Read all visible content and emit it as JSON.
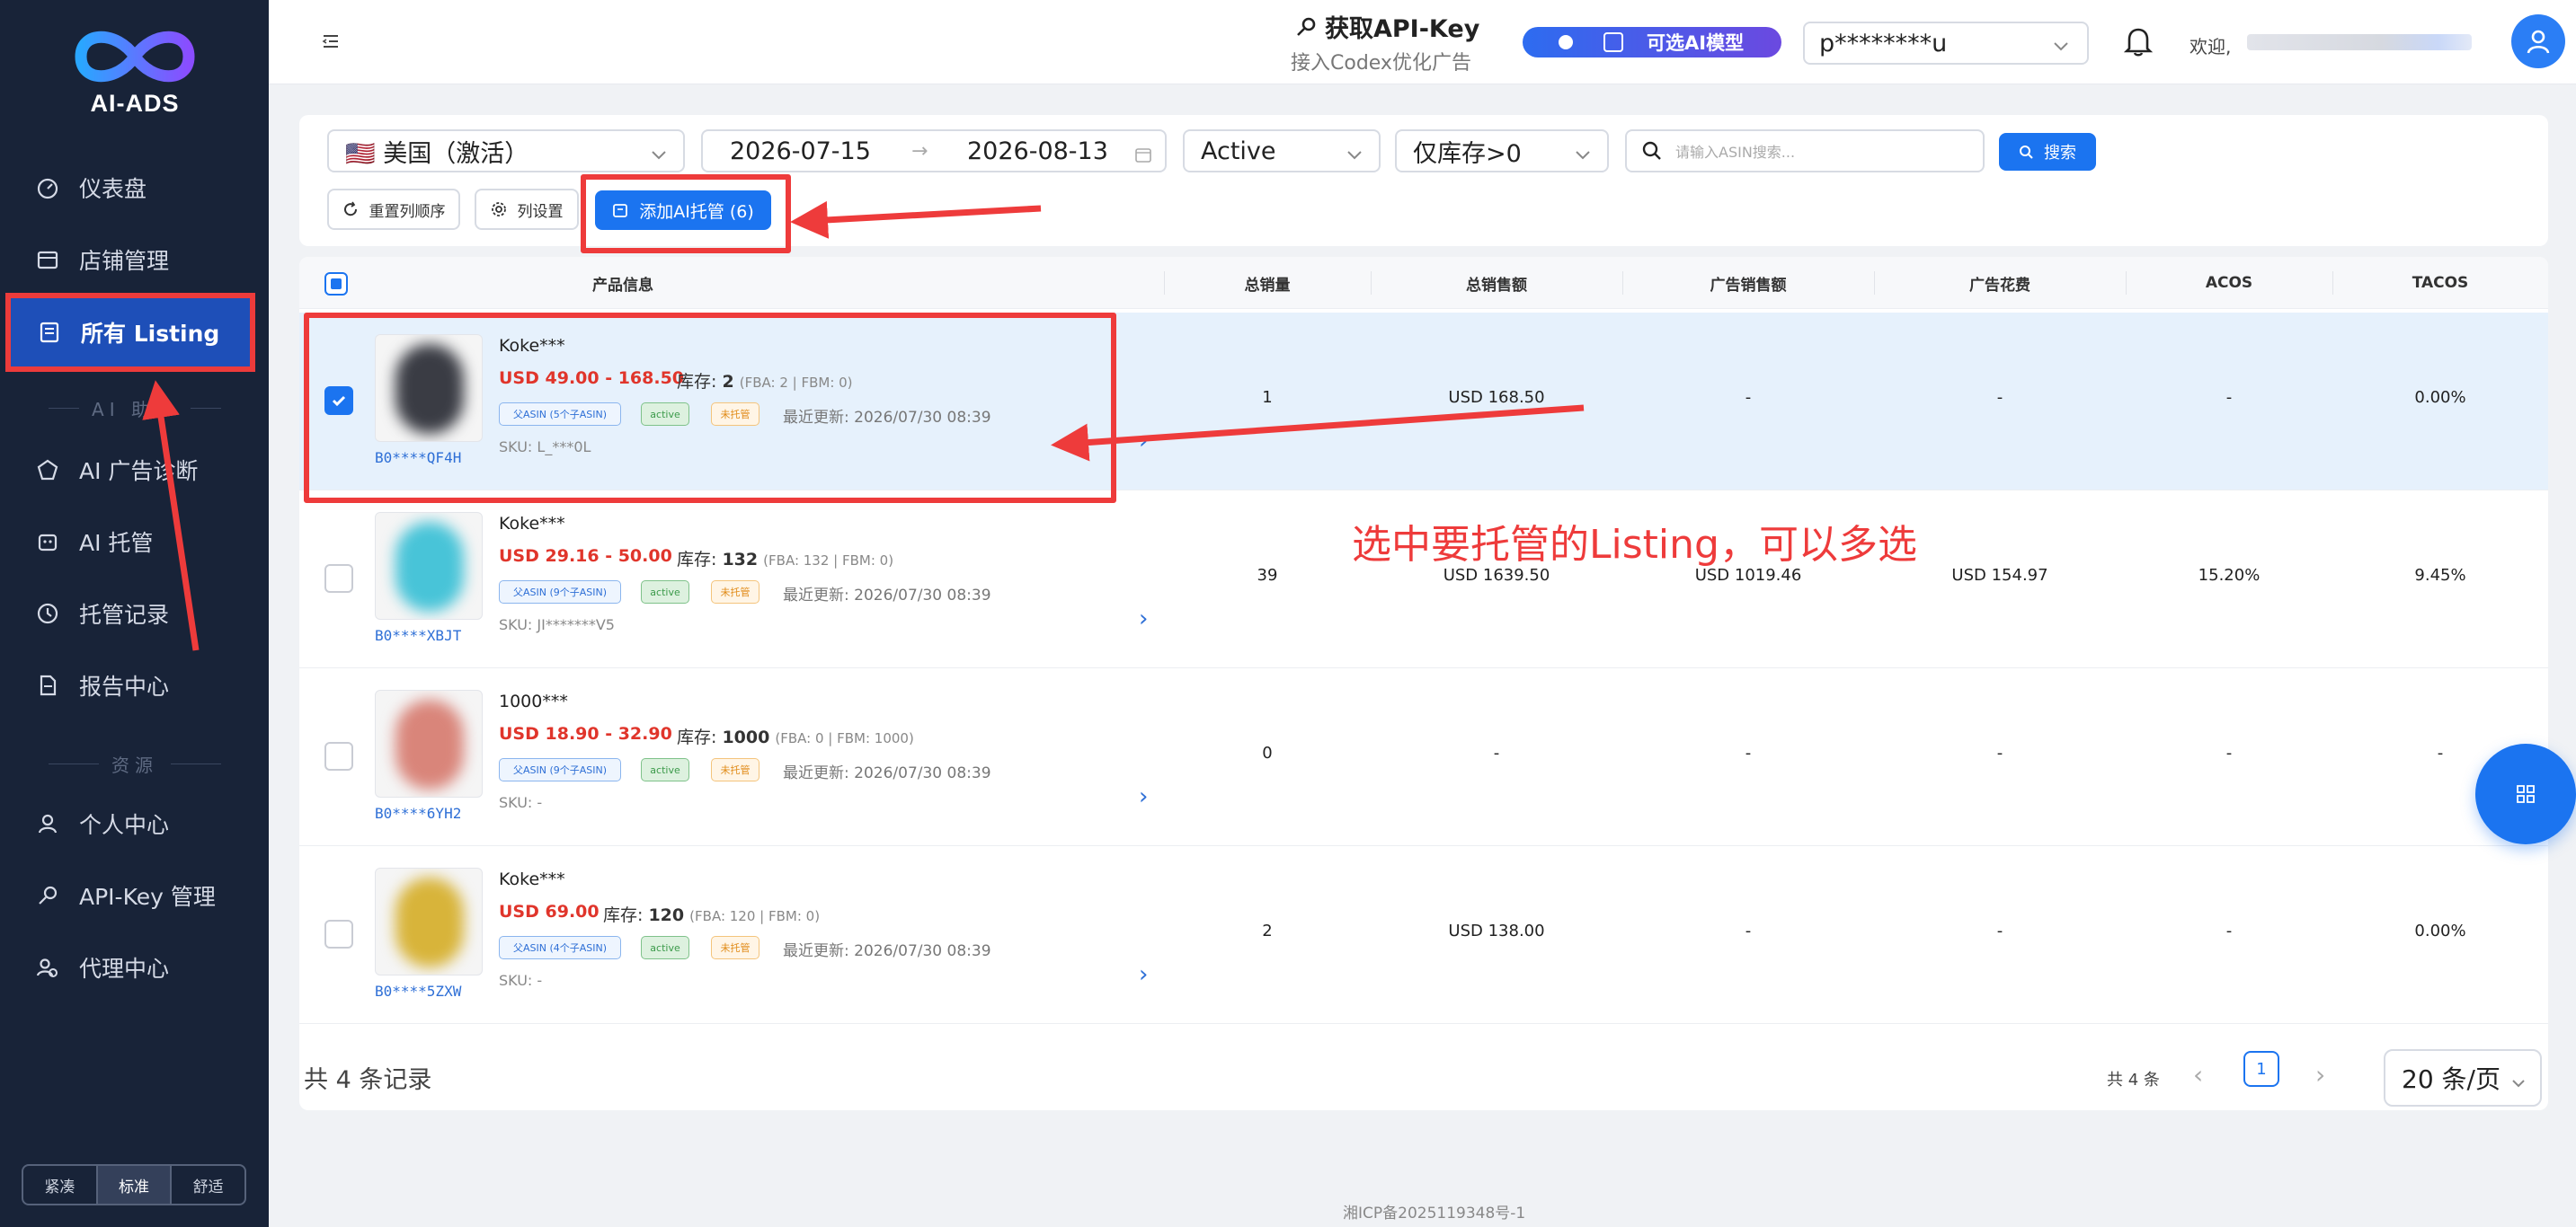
{
  "app": {
    "logo_text": "AI-ADS"
  },
  "sidebar": {
    "items": [
      {
        "label": "仪表盘",
        "icon": "dashboard-icon"
      },
      {
        "label": "店铺管理",
        "icon": "store-icon"
      },
      {
        "label": "所有 Listing",
        "icon": "listing-icon",
        "active": true
      }
    ],
    "section_ai": "AI 助手",
    "ai_items": [
      {
        "label": "AI 广告诊断",
        "icon": "diagnosis-icon"
      },
      {
        "label": "AI 托管",
        "icon": "robot-icon"
      },
      {
        "label": "托管记录",
        "icon": "history-icon"
      },
      {
        "label": "报告中心",
        "icon": "report-icon"
      }
    ],
    "section_resources": "资源",
    "resource_items": [
      {
        "label": "个人中心",
        "icon": "user-icon"
      },
      {
        "label": "API-Key 管理",
        "icon": "key-icon"
      },
      {
        "label": "代理中心",
        "icon": "agent-icon"
      }
    ],
    "density": [
      "紧凑",
      "标准",
      "舒适"
    ],
    "density_selected": "标准"
  },
  "header": {
    "api_title": "获取API-Key",
    "api_subtitle": "接入Codex优化广告",
    "ai_model_label": "可选AI模型",
    "account_value": "p********u",
    "welcome_label": "欢迎,"
  },
  "filters": {
    "marketplace": "🇺🇸 美国（激活）",
    "date_start": "2026-07-15",
    "date_arrow": "→",
    "date_end": "2026-08-13",
    "status": "Active",
    "stock": "仅库存>0",
    "search_placeholder": "请输入ASIN搜索...",
    "search_button": "搜索",
    "reset_columns": "重置列顺序",
    "column_settings": "列设置",
    "add_ai_hosting": "添加AI托管 (6)"
  },
  "table": {
    "columns": [
      "产品信息",
      "总销量",
      "总销售额",
      "广告销售额",
      "广告花费",
      "ACOS",
      "TACOS"
    ],
    "stock_label": "库存:",
    "updated_label": "最近更新:",
    "rows": [
      {
        "name": "Koke***",
        "price": "USD 49.00 - 168.50",
        "stock": "2",
        "stock_detail": "(FBA: 2 | FBM: 0)",
        "parent_tag": "父ASIN (5个子ASIN)",
        "status_tag": "active",
        "hosted_tag": "未托管",
        "updated": "2026/07/30 08:39",
        "sku": "SKU: L_***0L",
        "asin": "B0****QF4H",
        "total_units": "1",
        "total_sales": "USD 168.50",
        "ad_sales": "-",
        "ad_spend": "-",
        "acos": "-",
        "tacos": "0.00%",
        "selected": true,
        "thumb_color": "#3a3c44"
      },
      {
        "name": "Koke***",
        "price": "USD 29.16 - 50.00",
        "stock": "132",
        "stock_detail": "(FBA: 132 | FBM: 0)",
        "parent_tag": "父ASIN (9个子ASIN)",
        "status_tag": "active",
        "hosted_tag": "未托管",
        "updated": "2026/07/30 08:39",
        "sku": "SKU: JI*******V5",
        "asin": "B0****XBJT",
        "total_units": "39",
        "total_sales": "USD 1639.50",
        "ad_sales": "USD 1019.46",
        "ad_spend": "USD 154.97",
        "acos": "15.20%",
        "tacos": "9.45%",
        "selected": false,
        "thumb_color": "#48c4d8"
      },
      {
        "name": "1000***",
        "price": "USD 18.90 - 32.90",
        "stock": "1000",
        "stock_detail": "(FBA: 0 | FBM: 1000)",
        "parent_tag": "父ASIN (9个子ASIN)",
        "status_tag": "active",
        "hosted_tag": "未托管",
        "updated": "2026/07/30 08:39",
        "sku": "SKU: -",
        "asin": "B0****6YH2",
        "total_units": "0",
        "total_sales": "-",
        "ad_sales": "-",
        "ad_spend": "-",
        "acos": "-",
        "tacos": "-",
        "selected": false,
        "thumb_color": "#d9857a"
      },
      {
        "name": "Koke***",
        "price": "USD 69.00",
        "stock": "120",
        "stock_detail": "(FBA: 120 | FBM: 0)",
        "parent_tag": "父ASIN (4个子ASIN)",
        "status_tag": "active",
        "hosted_tag": "未托管",
        "updated": "2026/07/30 08:39",
        "sku": "SKU: -",
        "asin": "B0****5ZXW",
        "total_units": "2",
        "total_sales": "USD 138.00",
        "ad_sales": "-",
        "ad_spend": "-",
        "acos": "-",
        "tacos": "0.00%",
        "selected": false,
        "thumb_color": "#d8b43a"
      }
    ]
  },
  "footer": {
    "total_records": "共 4 条记录",
    "pagination_total": "共 4 条",
    "current_page": "1",
    "page_size": "20 条/页",
    "icp": "湘ICP备2025119348号-1"
  },
  "annotation": {
    "text": "选中要托管的Listing，可以多选",
    "color": "#ee3b3b"
  },
  "colors": {
    "primary": "#1b74f0",
    "sidebar_bg": "#182338",
    "price_red": "#e0352b"
  }
}
